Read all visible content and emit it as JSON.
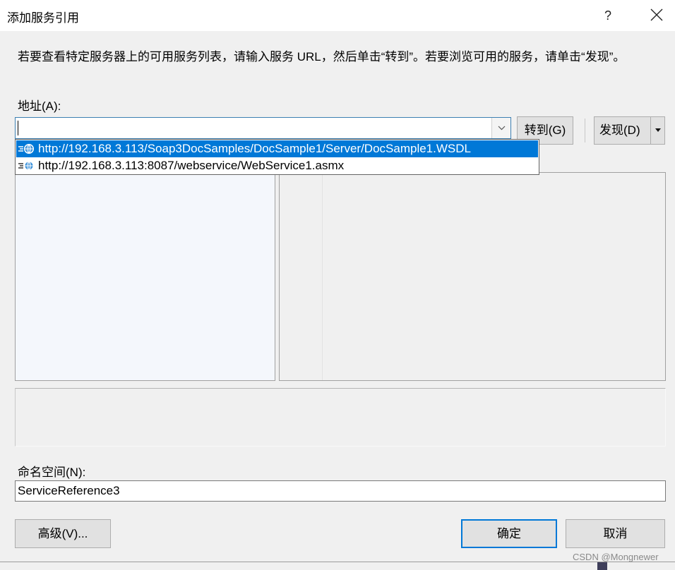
{
  "window": {
    "title": "添加服务引用",
    "help_label": "?"
  },
  "instructions": "若要查看特定服务器上的可用服务列表，请输入服务 URL，然后单击“转到”。若要浏览可用的服务，请单击“发现”。",
  "address": {
    "label": "地址(A):",
    "value": "",
    "go_button": "转到(G)",
    "discover_button": "发现(D)",
    "history": [
      {
        "url": "http://192.168.3.113/Soap3DocSamples/DocSample1/Server/DocSample1.WSDL",
        "selected": true
      },
      {
        "url": "http://192.168.3.113:8087/webservice/WebService1.asmx",
        "selected": false
      }
    ]
  },
  "namespace": {
    "label": "命名空间(N):",
    "value": "ServiceReference3"
  },
  "footer": {
    "advanced_button": "高级(V)...",
    "ok_button": "确定",
    "cancel_button": "取消"
  },
  "watermark": "CSDN @Mongnewer",
  "colors": {
    "selection": "#0078d7",
    "background": "#f0f0f0"
  }
}
